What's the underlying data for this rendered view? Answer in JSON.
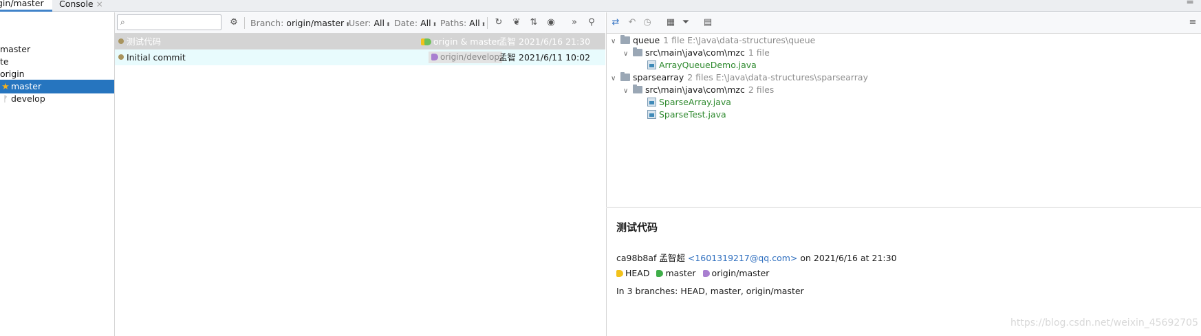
{
  "tabs": [
    {
      "label": "gin/master"
    },
    {
      "label": "Console",
      "close": "×"
    }
  ],
  "tabbar_right_icon": "≡",
  "branch_tree": [
    {
      "label": "master"
    },
    {
      "label": "te"
    },
    {
      "label": "origin"
    },
    {
      "label": "master",
      "icon": "star-icon",
      "selected": true
    },
    {
      "label": "develop",
      "icon": "branch-icon"
    }
  ],
  "toolbar": {
    "search_placeholder": "",
    "filters": [
      {
        "key": "Branch:",
        "value": "origin/master"
      },
      {
        "key": "User:",
        "value": "All"
      },
      {
        "key": "Date:",
        "value": "All"
      },
      {
        "key": "Paths:",
        "value": "All"
      }
    ]
  },
  "commits": [
    {
      "message": "测试代码",
      "refs": "origin & master",
      "author": "孟智",
      "date": "2021/6/16 21:30"
    },
    {
      "message": "Initial commit",
      "refs": "origin/develop",
      "author": "孟智",
      "date": "2021/6/11 10:02"
    }
  ],
  "changes_tree": [
    {
      "name": "queue",
      "meta": "1 file  E:\\Java\\data-structures\\queue",
      "children": [
        {
          "name": "src\\main\\java\\com\\mzc",
          "meta": "1 file",
          "files": [
            "ArrayQueueDemo.java"
          ]
        }
      ]
    },
    {
      "name": "sparsearray",
      "meta": "2 files  E:\\Java\\data-structures\\sparsearray",
      "children": [
        {
          "name": "src\\main\\java\\com\\mzc",
          "meta": "2 files",
          "files": [
            "SparseArray.java",
            "SparseTest.java"
          ]
        }
      ]
    }
  ],
  "details": {
    "title": "测试代码",
    "hash": "ca98b8af",
    "author": "孟智超",
    "email": "<1601319217@qq.com>",
    "on_text": "on 2021/6/16 at 21:30",
    "refs": [
      {
        "label": "HEAD",
        "color": "#f2c21b"
      },
      {
        "label": "master",
        "color": "#3fae49"
      },
      {
        "label": "origin/master",
        "color": "#a97fd0"
      }
    ],
    "branches_text": "In 3 branches: HEAD, master, origin/master"
  },
  "watermark": "https://blog.csdn.net/weixin_45692705",
  "colors": {
    "accent": "#2675bf",
    "selected_row": "#d4d4d4",
    "alt_row": "#e8fbfd",
    "graph": "#a8945e",
    "file_added": "#2f8a2f"
  }
}
